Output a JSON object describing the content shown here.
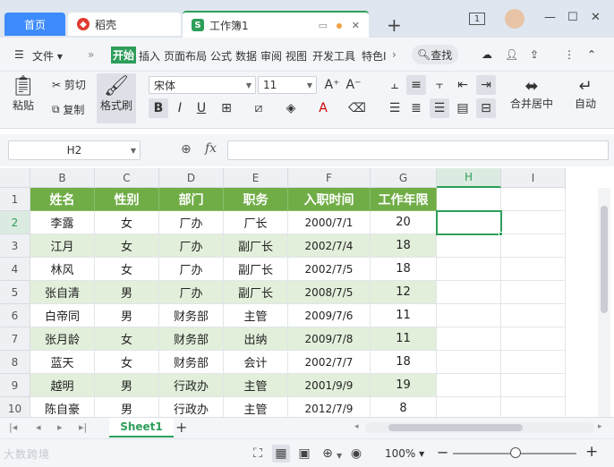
{
  "tabs": {
    "home": "首页",
    "daoke": "稻壳",
    "workbook": "工作簿1"
  },
  "window": {
    "tab_count": "1"
  },
  "menu": {
    "file": "文件",
    "items": [
      "开始",
      "插入",
      "页面布局",
      "公式",
      "数据",
      "审阅",
      "视图",
      "开发工具",
      "特色I"
    ],
    "search": "查找"
  },
  "ribbon": {
    "paste": "粘贴",
    "cut": "剪切",
    "copy": "复制",
    "format_painter": "格式刷",
    "font_name": "宋体",
    "font_size": "11",
    "merge_center": "合并居中",
    "auto_wrap": "自动"
  },
  "formula_bar": {
    "name_box": "H2",
    "fx": "fx",
    "formula": ""
  },
  "sheet": {
    "columns": [
      "B",
      "C",
      "D",
      "E",
      "F",
      "G",
      "H",
      "I"
    ],
    "rows": [
      "1",
      "2",
      "3",
      "4",
      "5",
      "6",
      "7",
      "8",
      "9",
      "10"
    ],
    "headers": [
      "姓名",
      "性别",
      "部门",
      "职务",
      "入职时间",
      "工作年限"
    ],
    "data": [
      [
        "李露",
        "女",
        "厂办",
        "厂长",
        "2000/7/1",
        "20"
      ],
      [
        "江月",
        "女",
        "厂办",
        "副厂长",
        "2002/7/4",
        "18"
      ],
      [
        "林风",
        "女",
        "厂办",
        "副厂长",
        "2002/7/5",
        "18"
      ],
      [
        "张自清",
        "男",
        "厂办",
        "副厂长",
        "2008/7/5",
        "12"
      ],
      [
        "白帝同",
        "男",
        "财务部",
        "主管",
        "2009/7/6",
        "11"
      ],
      [
        "张月龄",
        "女",
        "财务部",
        "出纳",
        "2009/7/8",
        "11"
      ],
      [
        "蓝天",
        "女",
        "财务部",
        "会计",
        "2002/7/7",
        "18"
      ],
      [
        "越明",
        "男",
        "行政办",
        "主管",
        "2001/9/9",
        "19"
      ],
      [
        "陈自豪",
        "男",
        "行政办",
        "主管",
        "2012/7/9",
        "8"
      ]
    ],
    "active_sheet": "Sheet1"
  },
  "status": {
    "zoom": "100%",
    "watermark": "大数跨境"
  },
  "colors": {
    "accent": "#2e9e5b",
    "header_fill": "#70ad47",
    "band_fill": "#e2efda",
    "tab_home": "#3d8bfd"
  }
}
